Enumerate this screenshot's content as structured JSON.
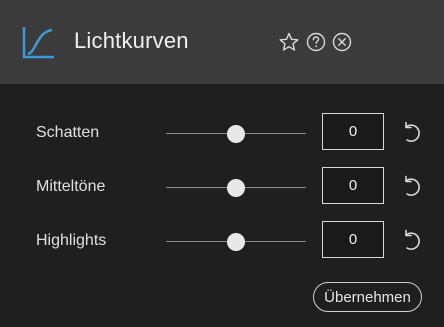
{
  "panel": {
    "title": "Lichtkurven",
    "title_icon": "curves-icon",
    "accent_color": "#3a9bd9",
    "titlebar_icons": [
      "star-icon",
      "help-icon",
      "close-icon"
    ]
  },
  "adjustments": [
    {
      "label": "Schatten",
      "value": "0",
      "slider_level": 0.5
    },
    {
      "label": "Mitteltöne",
      "value": "0",
      "slider_level": 0.5
    },
    {
      "label": "Highlights",
      "value": "0",
      "slider_level": 0.5
    }
  ],
  "apply_label": "Übernehmen"
}
